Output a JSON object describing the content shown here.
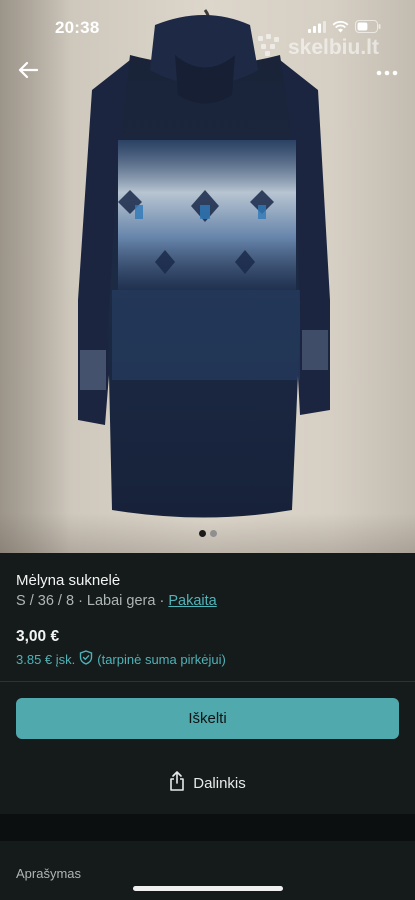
{
  "status_bar": {
    "time": "20:38",
    "battery_percent": 55
  },
  "watermark": {
    "text": "skelbiu.lt"
  },
  "gallery": {
    "image_count": 2,
    "active_index": 0
  },
  "item": {
    "title": "Mėlyna suknelė",
    "meta": "S / 36 / 8 · Labai gera · ",
    "brand": "Pakaita",
    "price": "3,00 €",
    "price_incl": "3.85 € įsk.",
    "price_incl_note": "(tarpinė suma pirkėjui)"
  },
  "actions": {
    "buy_label": "Iškelti",
    "share_label": "Dalinkis"
  },
  "description": {
    "label": "Aprašymas"
  },
  "colors": {
    "accent": "#4fa9ad",
    "link": "#4fb3b8",
    "background": "#151a1a"
  }
}
